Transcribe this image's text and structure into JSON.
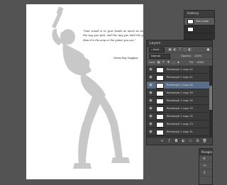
{
  "canvas": {
    "quote_text": "\"Your sound is in your hands as much as anything. It's the way you pick, and the way you hold the guitar, more than it is the amp or the guitar you use.\"",
    "quote_author": "- Stevie Ray Vaughan"
  },
  "history_panel": {
    "title": "History",
    "items": [
      {
        "label": "Text Quote"
      },
      {
        "label": ""
      }
    ]
  },
  "layers_panel": {
    "title": "Layers",
    "kind_filter": "Kind",
    "blend_mode": "Normal",
    "opacity_label": "Opacity:",
    "opacity_value": "100%",
    "lock_label": "Lock:",
    "fill_label": "Fill:",
    "fill_value": "100%",
    "layers": [
      {
        "name": "Rectangle 1 copy 42"
      },
      {
        "name": "Rectangle 1 copy 41"
      },
      {
        "name": "Rectangle 1 copy 40"
      },
      {
        "name": "Rectangle 1 copy 39"
      },
      {
        "name": "Rectangle 1 copy 34"
      },
      {
        "name": "Rectangle 1 copy 33"
      },
      {
        "name": "Rectangle 1 copy 32"
      },
      {
        "name": "Rectangle 1 copy 23"
      },
      {
        "name": "Rectangle 1 copy 31"
      }
    ],
    "selected_index": 2
  },
  "bottom_panel": {
    "title": "Paragra"
  },
  "colors": {
    "workspace": "#535353",
    "panel_dark": "#3b3b3b",
    "selected_layer": "#5a6e8a",
    "silhouette": "#c8c8c8"
  }
}
